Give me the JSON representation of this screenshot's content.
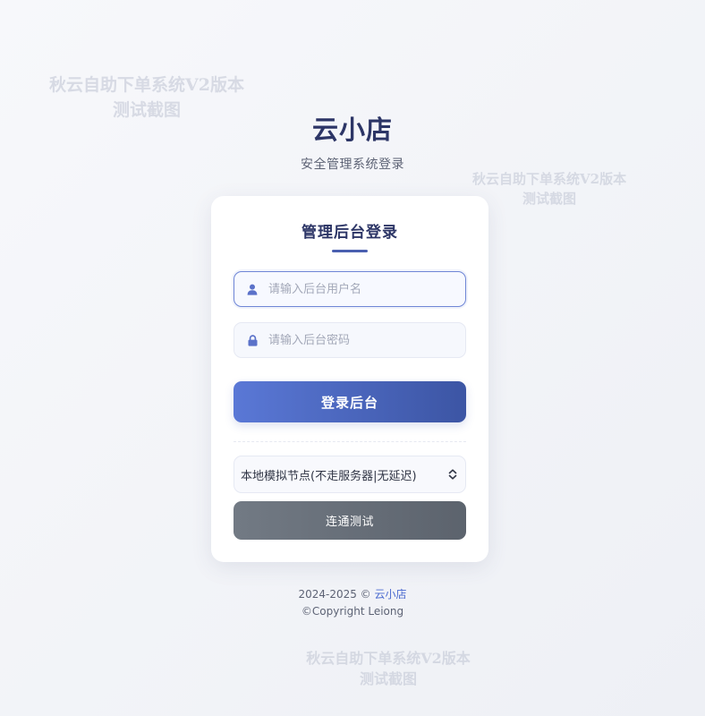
{
  "watermark": {
    "line1": "秋云自助下单系统V2版本",
    "line2": "测试截图"
  },
  "brand": {
    "title": "云小店",
    "subtitle": "安全管理系统登录"
  },
  "login_card": {
    "title": "管理后台登录",
    "username": {
      "value": "",
      "placeholder": "请输入后台用户名",
      "icon": "user-icon"
    },
    "password": {
      "value": "",
      "placeholder": "请输入后台密码",
      "icon": "lock-icon"
    },
    "submit_label": "登录后台",
    "node_select": {
      "selected": "本地模拟节点(不走服务器|无延迟)",
      "icon": "chevron-updown-icon"
    },
    "test_label": "连通测试"
  },
  "footer": {
    "years": "2024-2025 ©",
    "brand_link": "云小店",
    "copyright": "©Copyright Leiong"
  },
  "colors": {
    "accent": "#4a5fb0",
    "primary_button_start": "#5a78d6",
    "primary_button_end": "#3c55a4",
    "secondary_button": "#666d77",
    "link": "#4c6bd0"
  }
}
